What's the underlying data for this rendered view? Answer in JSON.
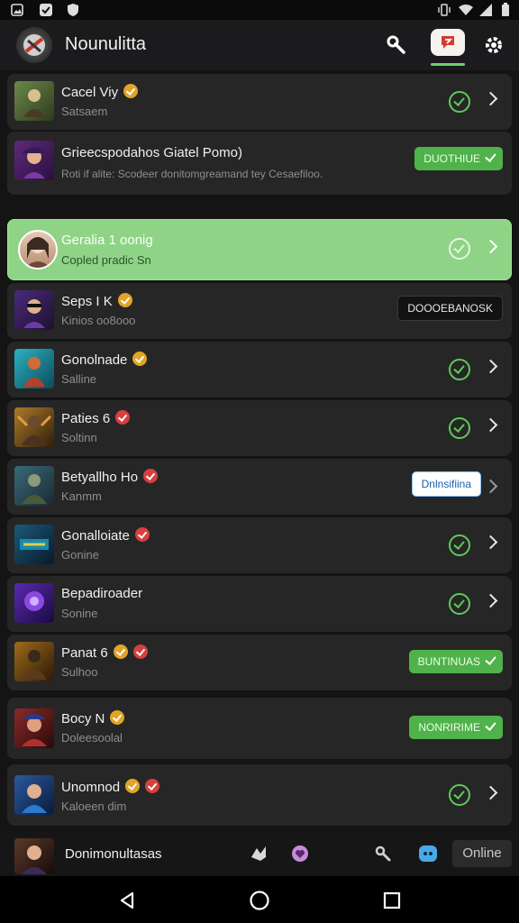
{
  "app": {
    "title": "Nounulitta"
  },
  "items": [
    {
      "name": "Cacel Viy",
      "sub": "Satsaem",
      "badges": [
        "gold"
      ],
      "action": "check"
    },
    {
      "name": "Grieecspodahos Giatel Pomo)",
      "sub": "Roti if alite: Scodeer donitomgreamand tey Cesaefiloo.",
      "badges": [],
      "action": "pill-green",
      "pill": "DUOTHIUE"
    },
    {
      "name": "Geralia 1 oonig",
      "sub": "Copled pradic Sn",
      "badges": [],
      "action": "check",
      "highlight": true
    },
    {
      "name": "Seps I K",
      "sub": "Kinios oo8ooo",
      "badges": [
        "gold"
      ],
      "action": "pill-dark",
      "pill": "DOOOEBANOSK"
    },
    {
      "name": "Gonolnade",
      "sub": "Salline",
      "badges": [
        "gold"
      ],
      "action": "check"
    },
    {
      "name": "Paties 6",
      "sub": "Soltinn",
      "badges": [
        "red"
      ],
      "action": "check"
    },
    {
      "name": "Betyallho Ho",
      "sub": "Kanmm",
      "badges": [
        "red"
      ],
      "action": "pill-white",
      "pill": "Dnlnsifiina"
    },
    {
      "name": "Gonalloiate",
      "sub": "Gonine",
      "badges": [
        "red"
      ],
      "action": "check"
    },
    {
      "name": "Bepadiroader",
      "sub": "Sonine",
      "badges": [],
      "action": "check"
    },
    {
      "name": "Panat 6",
      "sub": "Sulhoo",
      "badges": [
        "gold",
        "red"
      ],
      "action": "pill-green",
      "pill": "BUNTINUAS"
    },
    {
      "name": "Bocy N",
      "sub": "Doleesoolal",
      "badges": [
        "gold"
      ],
      "action": "pill-green",
      "pill": "NONRIRIME"
    },
    {
      "name": "Unomnod",
      "sub": "Kaloeen dim",
      "badges": [
        "gold",
        "red"
      ],
      "action": "check"
    }
  ],
  "bottom": {
    "title": "Donimonultasas",
    "online_label": "Online"
  },
  "icons": {
    "header": [
      "wrench-icon",
      "chat-icon",
      "gear-icon"
    ],
    "bottom": [
      "game-icon",
      "heart-icon",
      "wrench-icon",
      "discord-icon"
    ],
    "nav": [
      "back-icon",
      "home-icon",
      "recents-icon"
    ]
  },
  "colors": {
    "accent_green": "#4fb24a",
    "highlight_row": "#8fd486",
    "check_green": "#5ecb58",
    "badge_gold": "#e2a426",
    "badge_red": "#d6403d"
  }
}
